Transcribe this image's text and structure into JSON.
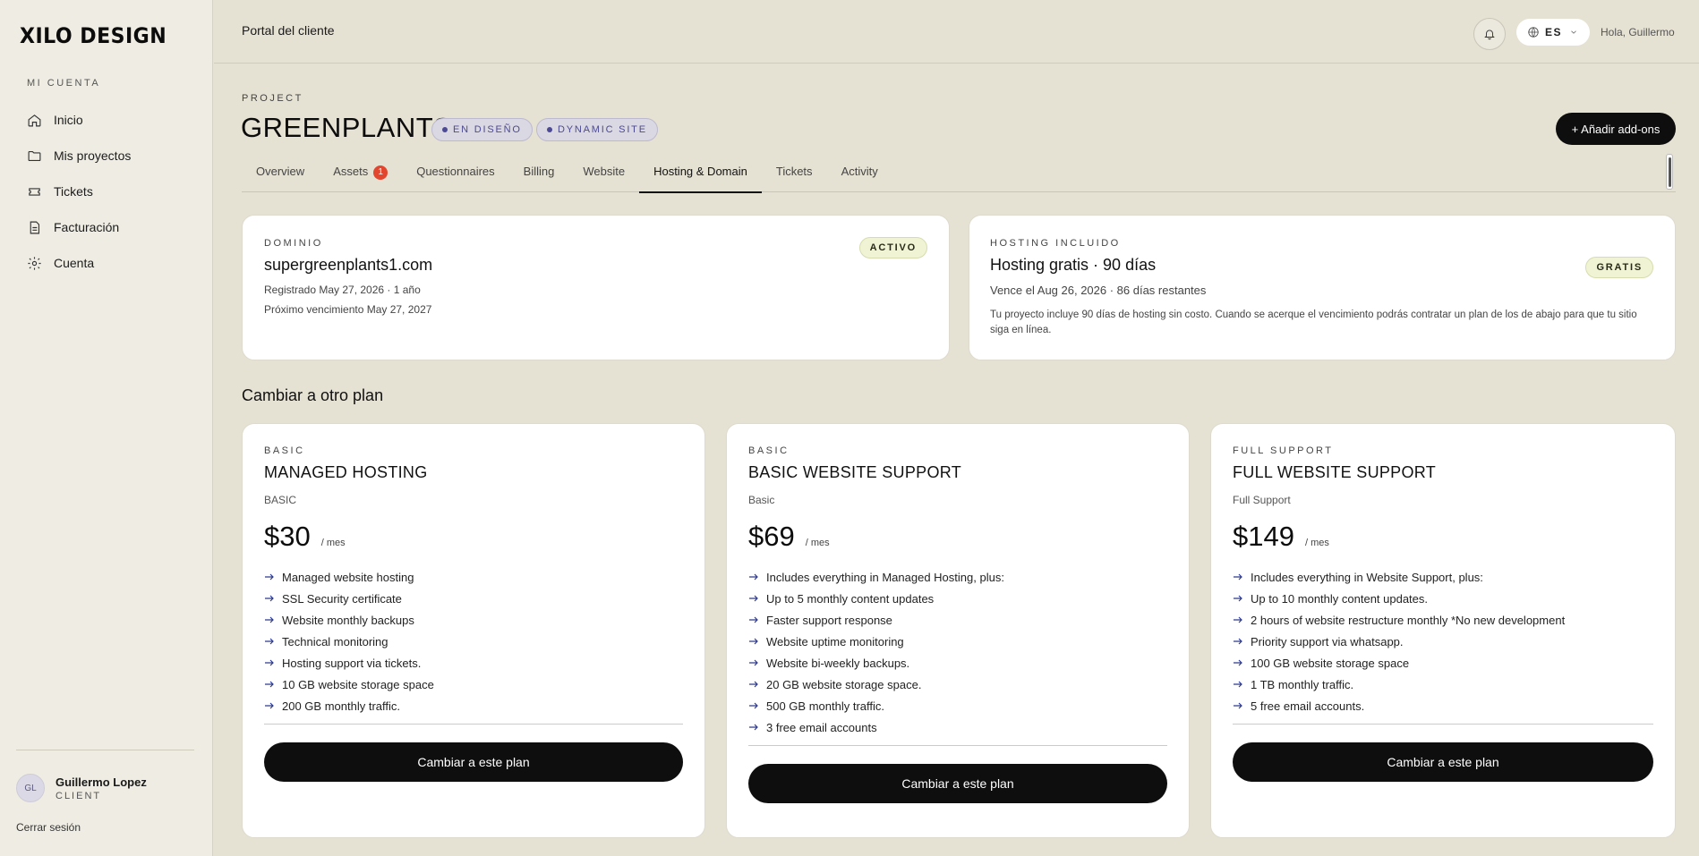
{
  "brand": {
    "logo": "XILO DESIGN"
  },
  "sidebar": {
    "section": "MI CUENTA",
    "items": [
      {
        "label": "Inicio",
        "icon": "home-icon"
      },
      {
        "label": "Mis proyectos",
        "icon": "folder-icon"
      },
      {
        "label": "Tickets",
        "icon": "ticket-icon"
      },
      {
        "label": "Facturación",
        "icon": "document-icon"
      },
      {
        "label": "Cuenta",
        "icon": "gear-icon"
      }
    ],
    "user": {
      "initials": "GL",
      "name": "Guillermo Lopez",
      "role": "CLIENT"
    },
    "logout": "Cerrar sesión"
  },
  "topbar": {
    "title": "Portal del cliente",
    "lang": "ES",
    "greeting": "Hola, Guillermo"
  },
  "project": {
    "label": "PROJECT",
    "title": "GREENPLANTS",
    "badges": [
      "EN DISEÑO",
      "DYNAMIC SITE"
    ],
    "addons_button": "+ Añadir add-ons"
  },
  "tabs": [
    {
      "label": "Overview"
    },
    {
      "label": "Assets",
      "count": "1"
    },
    {
      "label": "Questionnaires"
    },
    {
      "label": "Billing"
    },
    {
      "label": "Website"
    },
    {
      "label": "Hosting & Domain",
      "active": true
    },
    {
      "label": "Tickets"
    },
    {
      "label": "Activity"
    }
  ],
  "domain": {
    "eyebrow": "DOMINIO",
    "status": "ACTIVO",
    "name": "supergreenplants1.com",
    "registered": "Registrado May 27, 2026 · 1 año",
    "renewal": "Próximo vencimiento May 27, 2027"
  },
  "hosting": {
    "eyebrow": "HOSTING INCLUIDO",
    "status": "GRATIS",
    "title": "Hosting gratis · 90 días",
    "expires": "Vence el Aug 26, 2026 · 86 días restantes",
    "note": "Tu proyecto incluye 90 días de hosting sin costo. Cuando se acerque el vencimiento podrás contratar un plan de los de abajo para que tu sitio siga en línea."
  },
  "plans_section": {
    "title": "Cambiar a otro plan"
  },
  "plans": [
    {
      "eyebrow": "BASIC",
      "name": "MANAGED HOSTING",
      "sub": "BASIC",
      "price": "$30",
      "per": "/ mes",
      "features": [
        "Managed website hosting",
        "SSL Security certificate",
        "Website monthly backups",
        "Technical monitoring",
        "Hosting support via tickets.",
        "10 GB website storage space",
        "200 GB monthly traffic."
      ],
      "button": "Cambiar a este plan"
    },
    {
      "eyebrow": "BASIC",
      "name": "BASIC WEBSITE SUPPORT",
      "sub": "Basic",
      "price": "$69",
      "per": "/ mes",
      "features": [
        "Includes everything in Managed Hosting, plus:",
        "Up to 5 monthly content updates",
        "Faster support response",
        "Website uptime monitoring",
        "Website bi-weekly backups.",
        "20 GB website storage space.",
        "500 GB monthly traffic.",
        "3 free email accounts"
      ],
      "button": "Cambiar a este plan"
    },
    {
      "eyebrow": "FULL SUPPORT",
      "name": "FULL WEBSITE SUPPORT",
      "sub": "Full Support",
      "price": "$149",
      "per": "/ mes",
      "features": [
        "Includes everything in Website Support, plus:",
        "Up to 10 monthly content updates.",
        "2 hours of website restructure monthly *No new development",
        "Priority support via whatsapp.",
        "100 GB website storage space",
        "1 TB monthly traffic.",
        "5 free email accounts."
      ],
      "button": "Cambiar a este plan"
    }
  ]
}
